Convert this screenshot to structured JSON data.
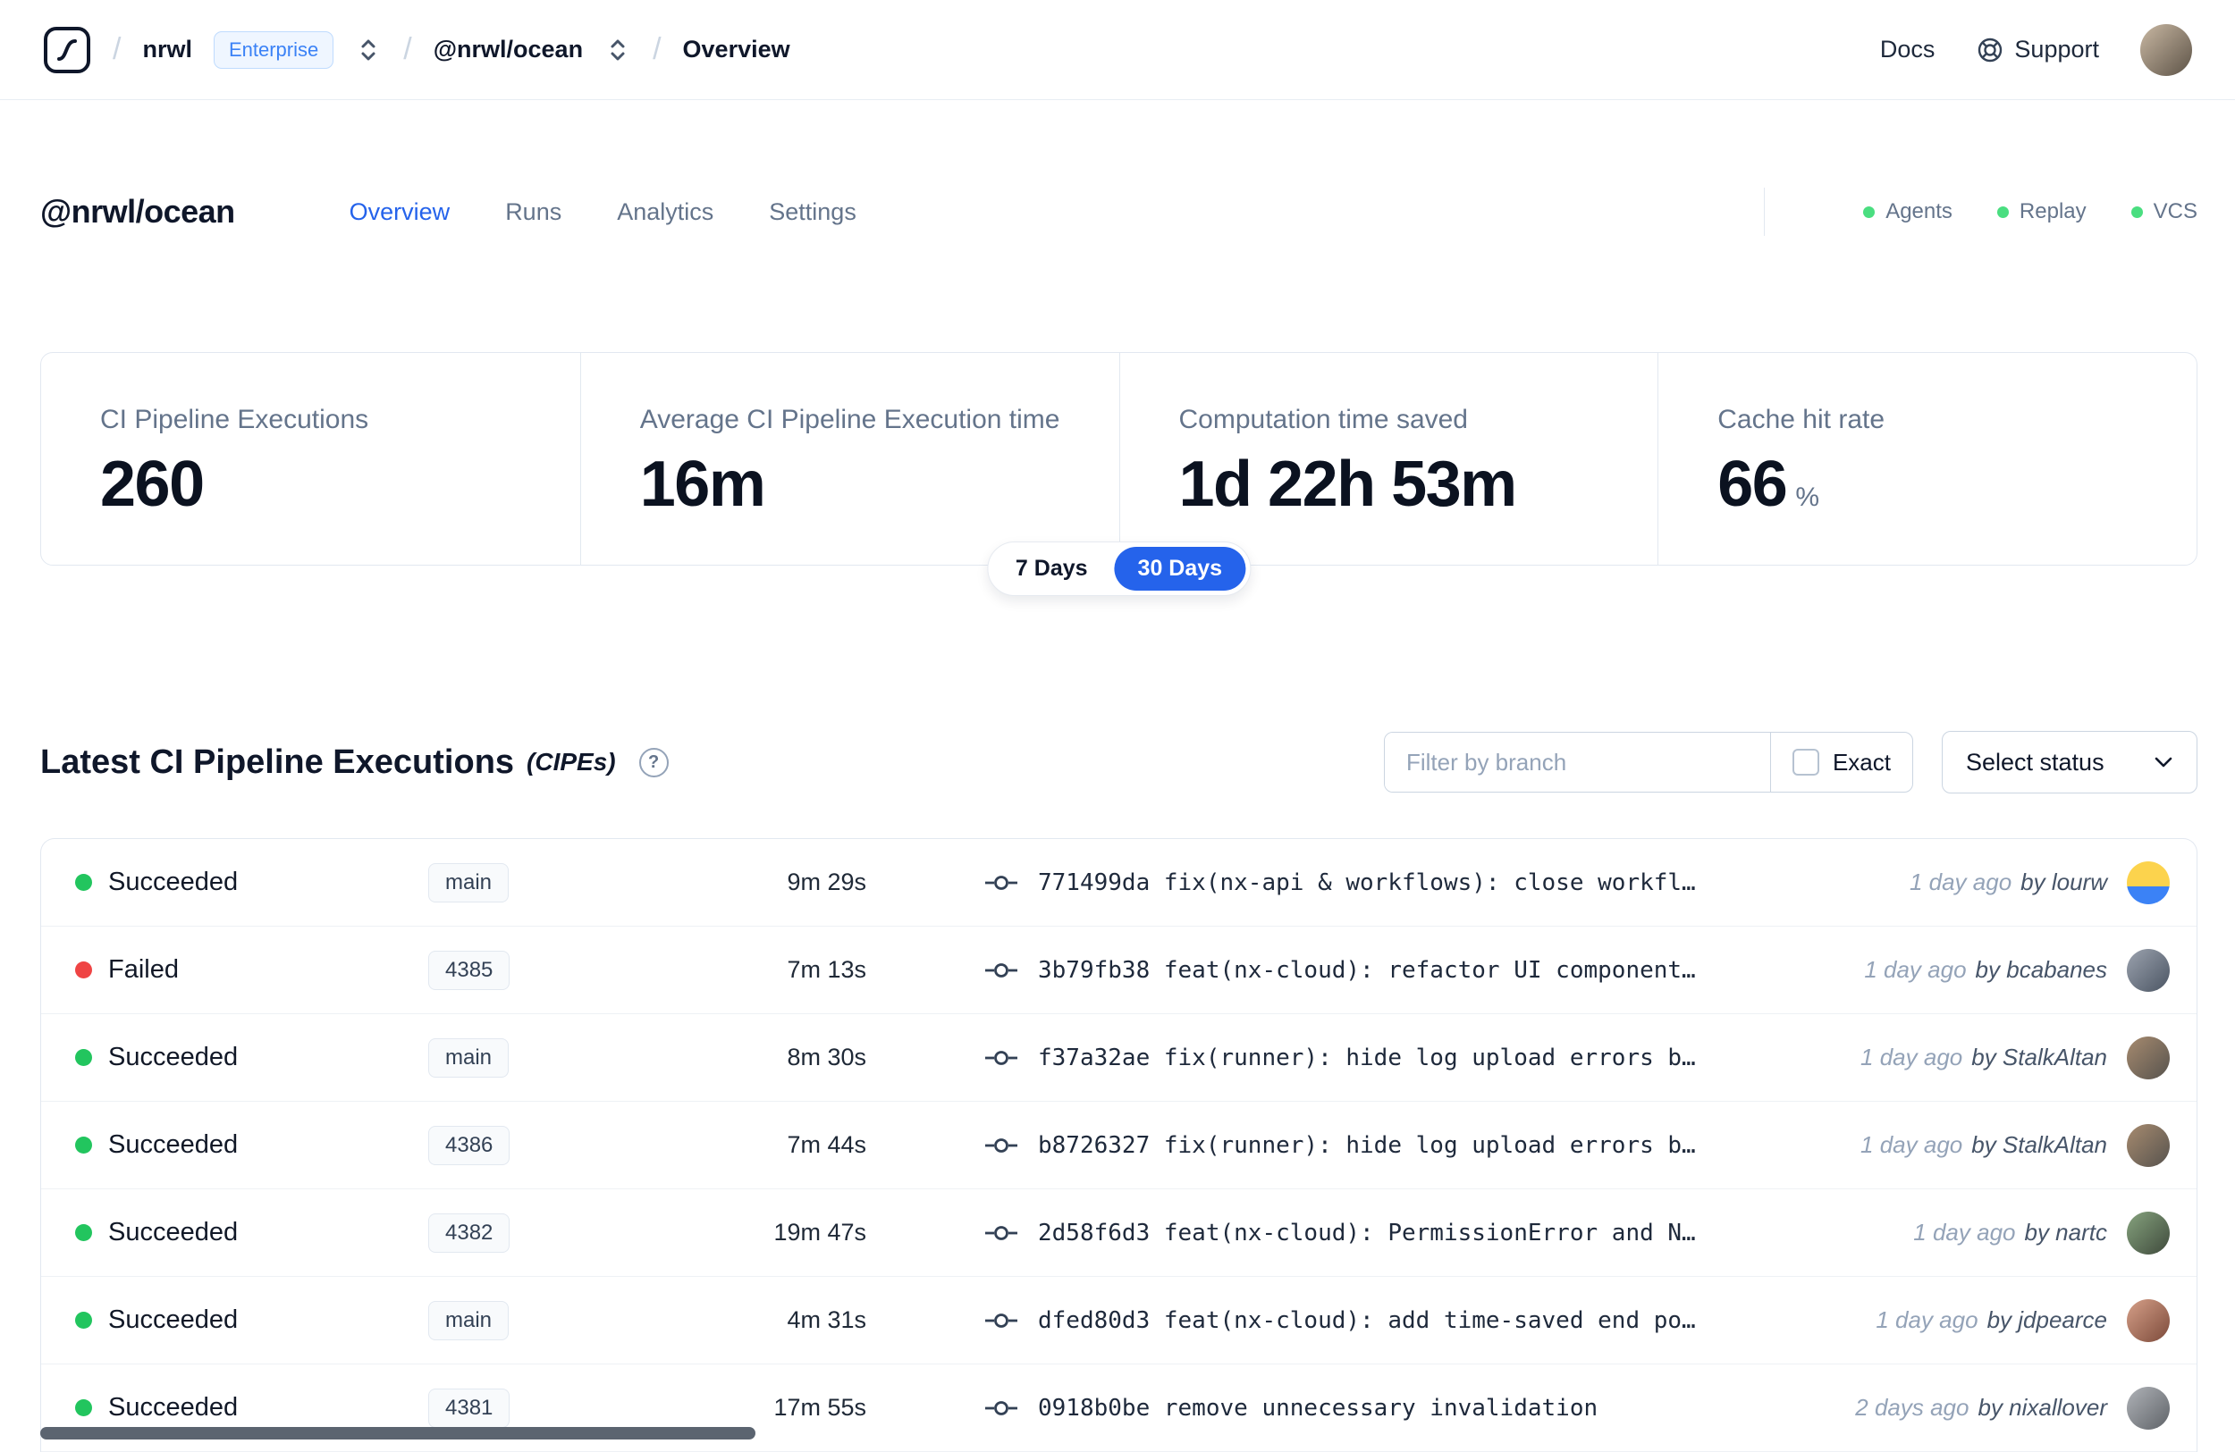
{
  "colors": {
    "accent": "#2563eb",
    "success": "#22c55e",
    "danger": "#ef4444",
    "integration_dot": "#4ade80"
  },
  "header": {
    "separator": "/",
    "org": "nrwl",
    "org_badge": "Enterprise",
    "workspace": "@nrwl/ocean",
    "page": "Overview",
    "docs_label": "Docs",
    "support_label": "Support",
    "avatar_color": "linear-gradient(135deg,#c9b8a3,#5d5347)"
  },
  "page": {
    "title": "@nrwl/ocean",
    "tabs": [
      {
        "label": "Overview",
        "active": true
      },
      {
        "label": "Runs",
        "active": false
      },
      {
        "label": "Analytics",
        "active": false
      },
      {
        "label": "Settings",
        "active": false
      }
    ],
    "integrations": [
      {
        "label": "Agents"
      },
      {
        "label": "Replay"
      },
      {
        "label": "VCS"
      }
    ]
  },
  "stats": [
    {
      "label": "CI Pipeline Executions",
      "value": "260",
      "unit": ""
    },
    {
      "label": "Average CI Pipeline Execution time",
      "value": "16m",
      "unit": ""
    },
    {
      "label": "Computation time saved",
      "value": "1d 22h 53m",
      "unit": ""
    },
    {
      "label": "Cache hit rate",
      "value": "66",
      "unit": "%"
    }
  ],
  "period_toggle": {
    "options": [
      "7 Days",
      "30 Days"
    ],
    "selected": "30 Days"
  },
  "cipe": {
    "title": "Latest CI Pipeline Executions",
    "subtitle": "(CIPEs)",
    "help_glyph": "?",
    "filter_placeholder": "Filter by branch",
    "exact_label": "Exact",
    "status_dropdown_label": "Select status"
  },
  "rows": [
    {
      "status": "Succeeded",
      "status_color": "#22c55e",
      "branch": "main",
      "duration": "9m 29s",
      "commit": "771499da fix(nx-api & workflows): close workfl…",
      "time": "1 day ago",
      "author": "by lourw",
      "avatar_color": "linear-gradient(180deg,#fcd34d 58%,#3b82f6 58%)"
    },
    {
      "status": "Failed",
      "status_color": "#ef4444",
      "branch": "4385",
      "duration": "7m 13s",
      "commit": "3b79fb38 feat(nx-cloud): refactor UI component…",
      "time": "1 day ago",
      "author": "by bcabanes",
      "avatar_color": "linear-gradient(135deg,#9ca3af,#4b5563)"
    },
    {
      "status": "Succeeded",
      "status_color": "#22c55e",
      "branch": "main",
      "duration": "8m 30s",
      "commit": "f37a32ae fix(runner): hide log upload errors b…",
      "time": "1 day ago",
      "author": "by StalkAltan",
      "avatar_color": "linear-gradient(135deg,#a78b6f,#57534e)"
    },
    {
      "status": "Succeeded",
      "status_color": "#22c55e",
      "branch": "4386",
      "duration": "7m 44s",
      "commit": "b8726327 fix(runner): hide log upload errors b…",
      "time": "1 day ago",
      "author": "by StalkAltan",
      "avatar_color": "linear-gradient(135deg,#a78b6f,#57534e)"
    },
    {
      "status": "Succeeded",
      "status_color": "#22c55e",
      "branch": "4382",
      "duration": "19m 47s",
      "commit": "2d58f6d3 feat(nx-cloud): PermissionError and N…",
      "time": "1 day ago",
      "author": "by nartc",
      "avatar_color": "linear-gradient(135deg,#86a37e,#3f4a3c)"
    },
    {
      "status": "Succeeded",
      "status_color": "#22c55e",
      "branch": "main",
      "duration": "4m 31s",
      "commit": "dfed80d3 feat(nx-cloud): add time-saved end po…",
      "time": "1 day ago",
      "author": "by jdpearce",
      "avatar_color": "linear-gradient(135deg,#d6a089,#7c4a3a)"
    },
    {
      "status": "Succeeded",
      "status_color": "#22c55e",
      "branch": "4381",
      "duration": "17m 55s",
      "commit": "0918b0be remove unnecessary invalidation",
      "time": "2 days ago",
      "author": "by nixallover",
      "avatar_color": "linear-gradient(135deg,#b0b3b8,#5f6368)"
    }
  ]
}
